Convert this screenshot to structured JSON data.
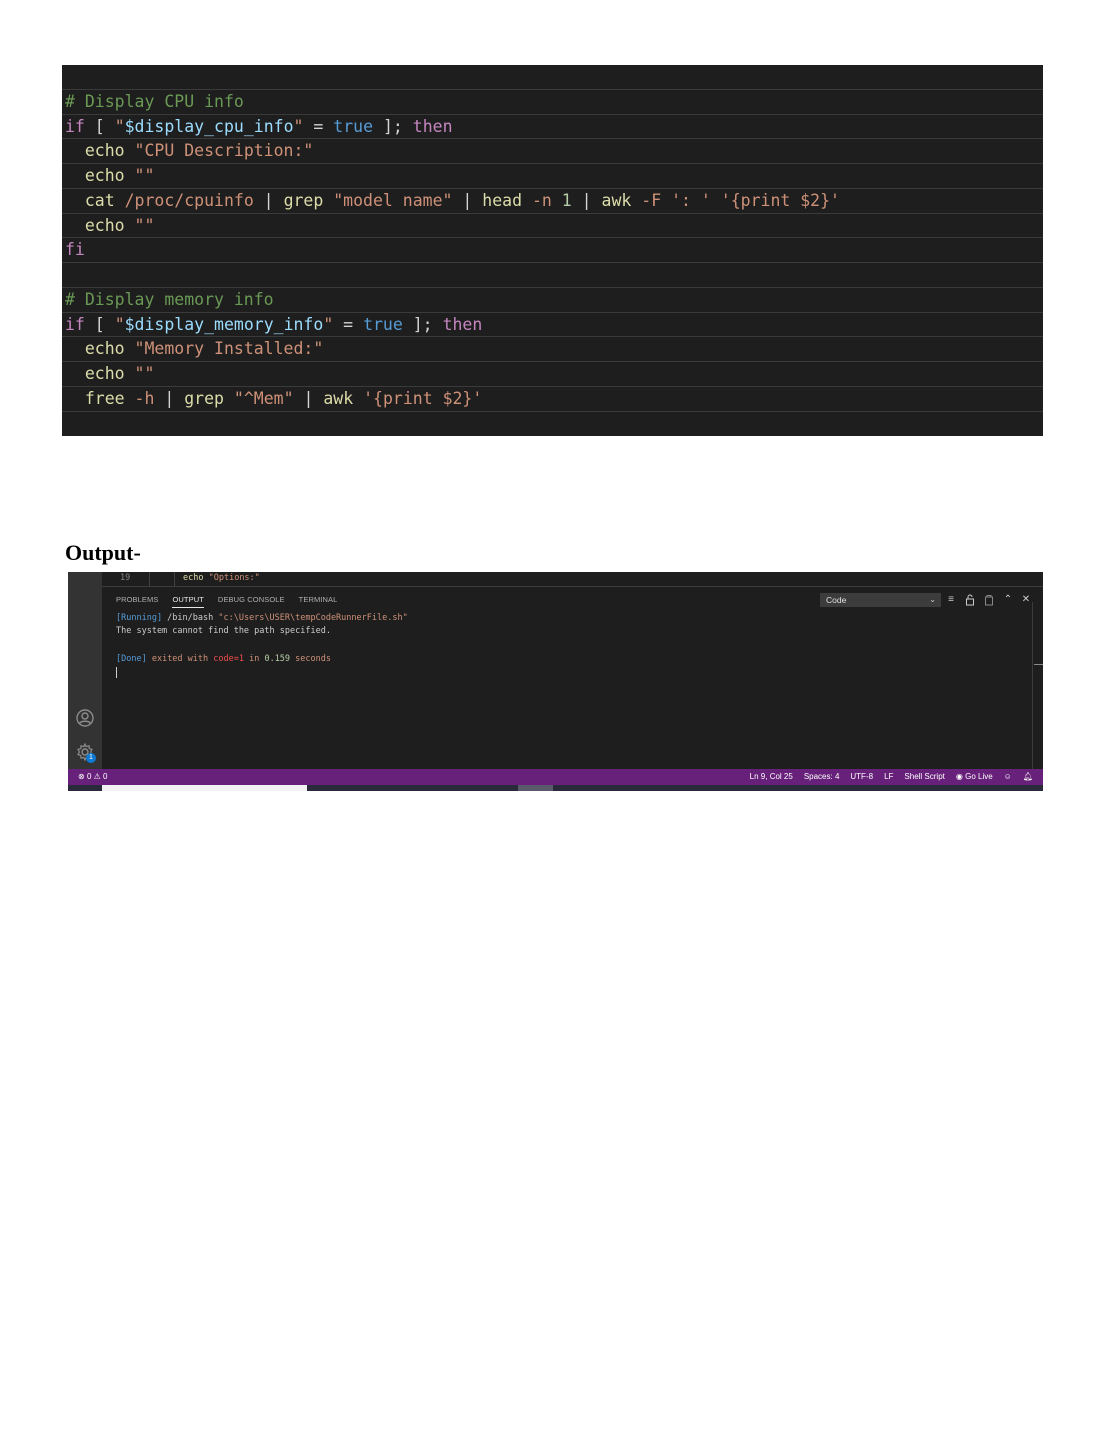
{
  "code": {
    "lines": [
      [],
      [
        {
          "t": "# Display CPU info",
          "c": "comment"
        }
      ],
      [
        {
          "t": "if",
          "c": "keyword"
        },
        {
          "t": " [ ",
          "c": "plain"
        },
        {
          "t": "\"",
          "c": "string"
        },
        {
          "t": "$display_cpu_info",
          "c": "var"
        },
        {
          "t": "\"",
          "c": "string"
        },
        {
          "t": " = ",
          "c": "plain"
        },
        {
          "t": "true",
          "c": "bool"
        },
        {
          "t": " ]; ",
          "c": "plain"
        },
        {
          "t": "then",
          "c": "keyword"
        }
      ],
      [
        {
          "t": "  echo",
          "c": "builtin"
        },
        {
          "t": " ",
          "c": "plain"
        },
        {
          "t": "\"CPU Description:\"",
          "c": "string"
        }
      ],
      [
        {
          "t": "  echo",
          "c": "builtin"
        },
        {
          "t": " ",
          "c": "plain"
        },
        {
          "t": "\"\"",
          "c": "string"
        }
      ],
      [
        {
          "t": "  cat",
          "c": "builtin"
        },
        {
          "t": " ",
          "c": "plain"
        },
        {
          "t": "/proc/cpuinfo",
          "c": "string"
        },
        {
          "t": " | ",
          "c": "plain"
        },
        {
          "t": "grep",
          "c": "builtin"
        },
        {
          "t": " ",
          "c": "plain"
        },
        {
          "t": "\"model name\"",
          "c": "string"
        },
        {
          "t": " | ",
          "c": "plain"
        },
        {
          "t": "head",
          "c": "builtin"
        },
        {
          "t": " ",
          "c": "plain"
        },
        {
          "t": "-n",
          "c": "string"
        },
        {
          "t": " ",
          "c": "plain"
        },
        {
          "t": "1",
          "c": "num"
        },
        {
          "t": " | ",
          "c": "plain"
        },
        {
          "t": "awk",
          "c": "builtin"
        },
        {
          "t": " ",
          "c": "plain"
        },
        {
          "t": "-F",
          "c": "string"
        },
        {
          "t": " ",
          "c": "plain"
        },
        {
          "t": "': '",
          "c": "string"
        },
        {
          "t": " ",
          "c": "plain"
        },
        {
          "t": "'{print $2}'",
          "c": "string"
        }
      ],
      [
        {
          "t": "  echo",
          "c": "builtin"
        },
        {
          "t": " ",
          "c": "plain"
        },
        {
          "t": "\"\"",
          "c": "string"
        }
      ],
      [
        {
          "t": "fi",
          "c": "keyword"
        }
      ],
      [],
      [
        {
          "t": "# Display memory info",
          "c": "comment"
        }
      ],
      [
        {
          "t": "if",
          "c": "keyword"
        },
        {
          "t": " [ ",
          "c": "plain"
        },
        {
          "t": "\"",
          "c": "string"
        },
        {
          "t": "$display_memory_info",
          "c": "var"
        },
        {
          "t": "\"",
          "c": "string"
        },
        {
          "t": " = ",
          "c": "plain"
        },
        {
          "t": "true",
          "c": "bool"
        },
        {
          "t": " ]; ",
          "c": "plain"
        },
        {
          "t": "then",
          "c": "keyword"
        }
      ],
      [
        {
          "t": "  echo",
          "c": "builtin"
        },
        {
          "t": " ",
          "c": "plain"
        },
        {
          "t": "\"Memory Installed:\"",
          "c": "string"
        }
      ],
      [
        {
          "t": "  echo",
          "c": "builtin"
        },
        {
          "t": " ",
          "c": "plain"
        },
        {
          "t": "\"\"",
          "c": "string"
        }
      ],
      [
        {
          "t": "  free",
          "c": "builtin"
        },
        {
          "t": " ",
          "c": "plain"
        },
        {
          "t": "-h",
          "c": "string"
        },
        {
          "t": " | ",
          "c": "plain"
        },
        {
          "t": "grep",
          "c": "builtin"
        },
        {
          "t": " ",
          "c": "plain"
        },
        {
          "t": "\"^Mem\"",
          "c": "string"
        },
        {
          "t": " | ",
          "c": "plain"
        },
        {
          "t": "awk",
          "c": "builtin"
        },
        {
          "t": " ",
          "c": "plain"
        },
        {
          "t": "'{print $2}'",
          "c": "string"
        }
      ],
      []
    ]
  },
  "heading": "Output-",
  "editor": {
    "line_number": "19",
    "code_keyword": "echo",
    "code_string": "\"Options:\""
  },
  "panel": {
    "tabs": [
      "PROBLEMS",
      "OUTPUT",
      "DEBUG CONSOLE",
      "TERMINAL"
    ],
    "active_tab": "OUTPUT",
    "channel_select": "Code",
    "output": {
      "running_tag": "[Running]",
      "running_cmd": " /bin/bash ",
      "running_path": "\"c:\\Users\\USER\\tempCodeRunnerFile.sh\"",
      "error_line": "The system cannot find the path specified.",
      "done_tag": "[Done]",
      "done_text1": " exited with ",
      "done_code": "code=1",
      "done_text2": " in ",
      "done_time": "0.159",
      "done_text3": " seconds"
    }
  },
  "status": {
    "errors": "0",
    "warnings": "0",
    "ln_col": "Ln 9, Col 25",
    "spaces": "Spaces: 4",
    "encoding": "UTF-8",
    "eol": "LF",
    "language": "Shell Script",
    "go_live": "Go Live"
  },
  "badge_count": "1",
  "colors": {
    "status_bar": "#68217a",
    "editor_bg": "#1e1e1e",
    "activity_bar": "#333333"
  }
}
